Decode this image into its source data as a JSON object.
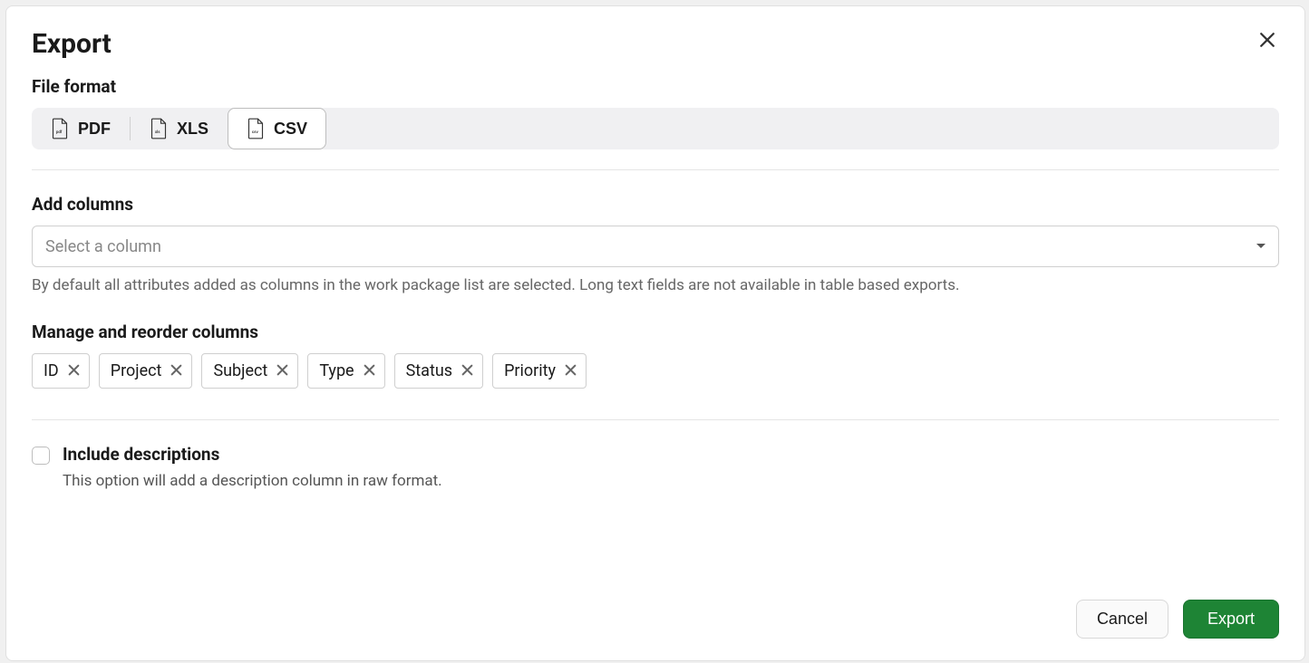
{
  "modal": {
    "title": "Export"
  },
  "file_format": {
    "label": "File format",
    "options": [
      "PDF",
      "XLS",
      "CSV"
    ],
    "selected": "CSV"
  },
  "add_columns": {
    "label": "Add columns",
    "placeholder": "Select a column",
    "helper": "By default all attributes added as columns in the work package list are selected. Long text fields are not available in table based exports."
  },
  "manage_columns": {
    "label": "Manage and reorder columns",
    "chips": [
      "ID",
      "Project",
      "Subject",
      "Type",
      "Status",
      "Priority"
    ]
  },
  "include_descriptions": {
    "label": "Include descriptions",
    "desc": "This option will add a description column in raw format.",
    "checked": false
  },
  "footer": {
    "cancel": "Cancel",
    "export": "Export"
  }
}
